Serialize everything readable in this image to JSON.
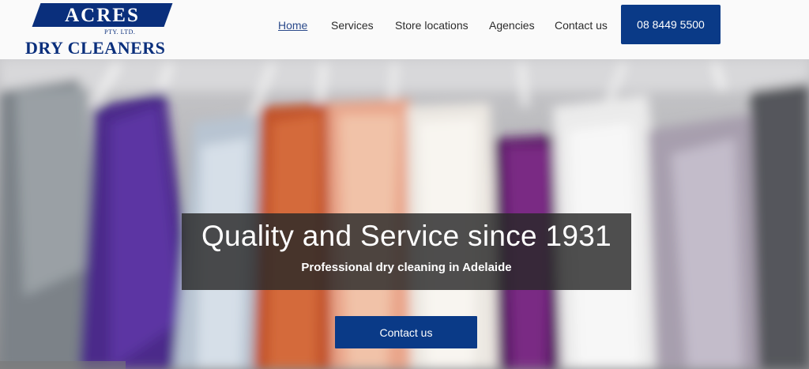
{
  "logo": {
    "brand": "ACRES",
    "pty": "PTY. LTD.",
    "tagline": "DRY CLEANERS"
  },
  "nav": {
    "items": [
      {
        "label": "Home",
        "active": true
      },
      {
        "label": "Services"
      },
      {
        "label": "Store locations"
      },
      {
        "label": "Agencies"
      },
      {
        "label": "Contact us"
      }
    ],
    "phone": "08 8449 5500"
  },
  "hero": {
    "title": "Quality and Service since 1931",
    "subtitle": "Professional dry cleaning in Adelaide",
    "cta": "Contact us"
  },
  "colors": {
    "brand": "#0a2f7c",
    "button": "#0a3a87"
  }
}
